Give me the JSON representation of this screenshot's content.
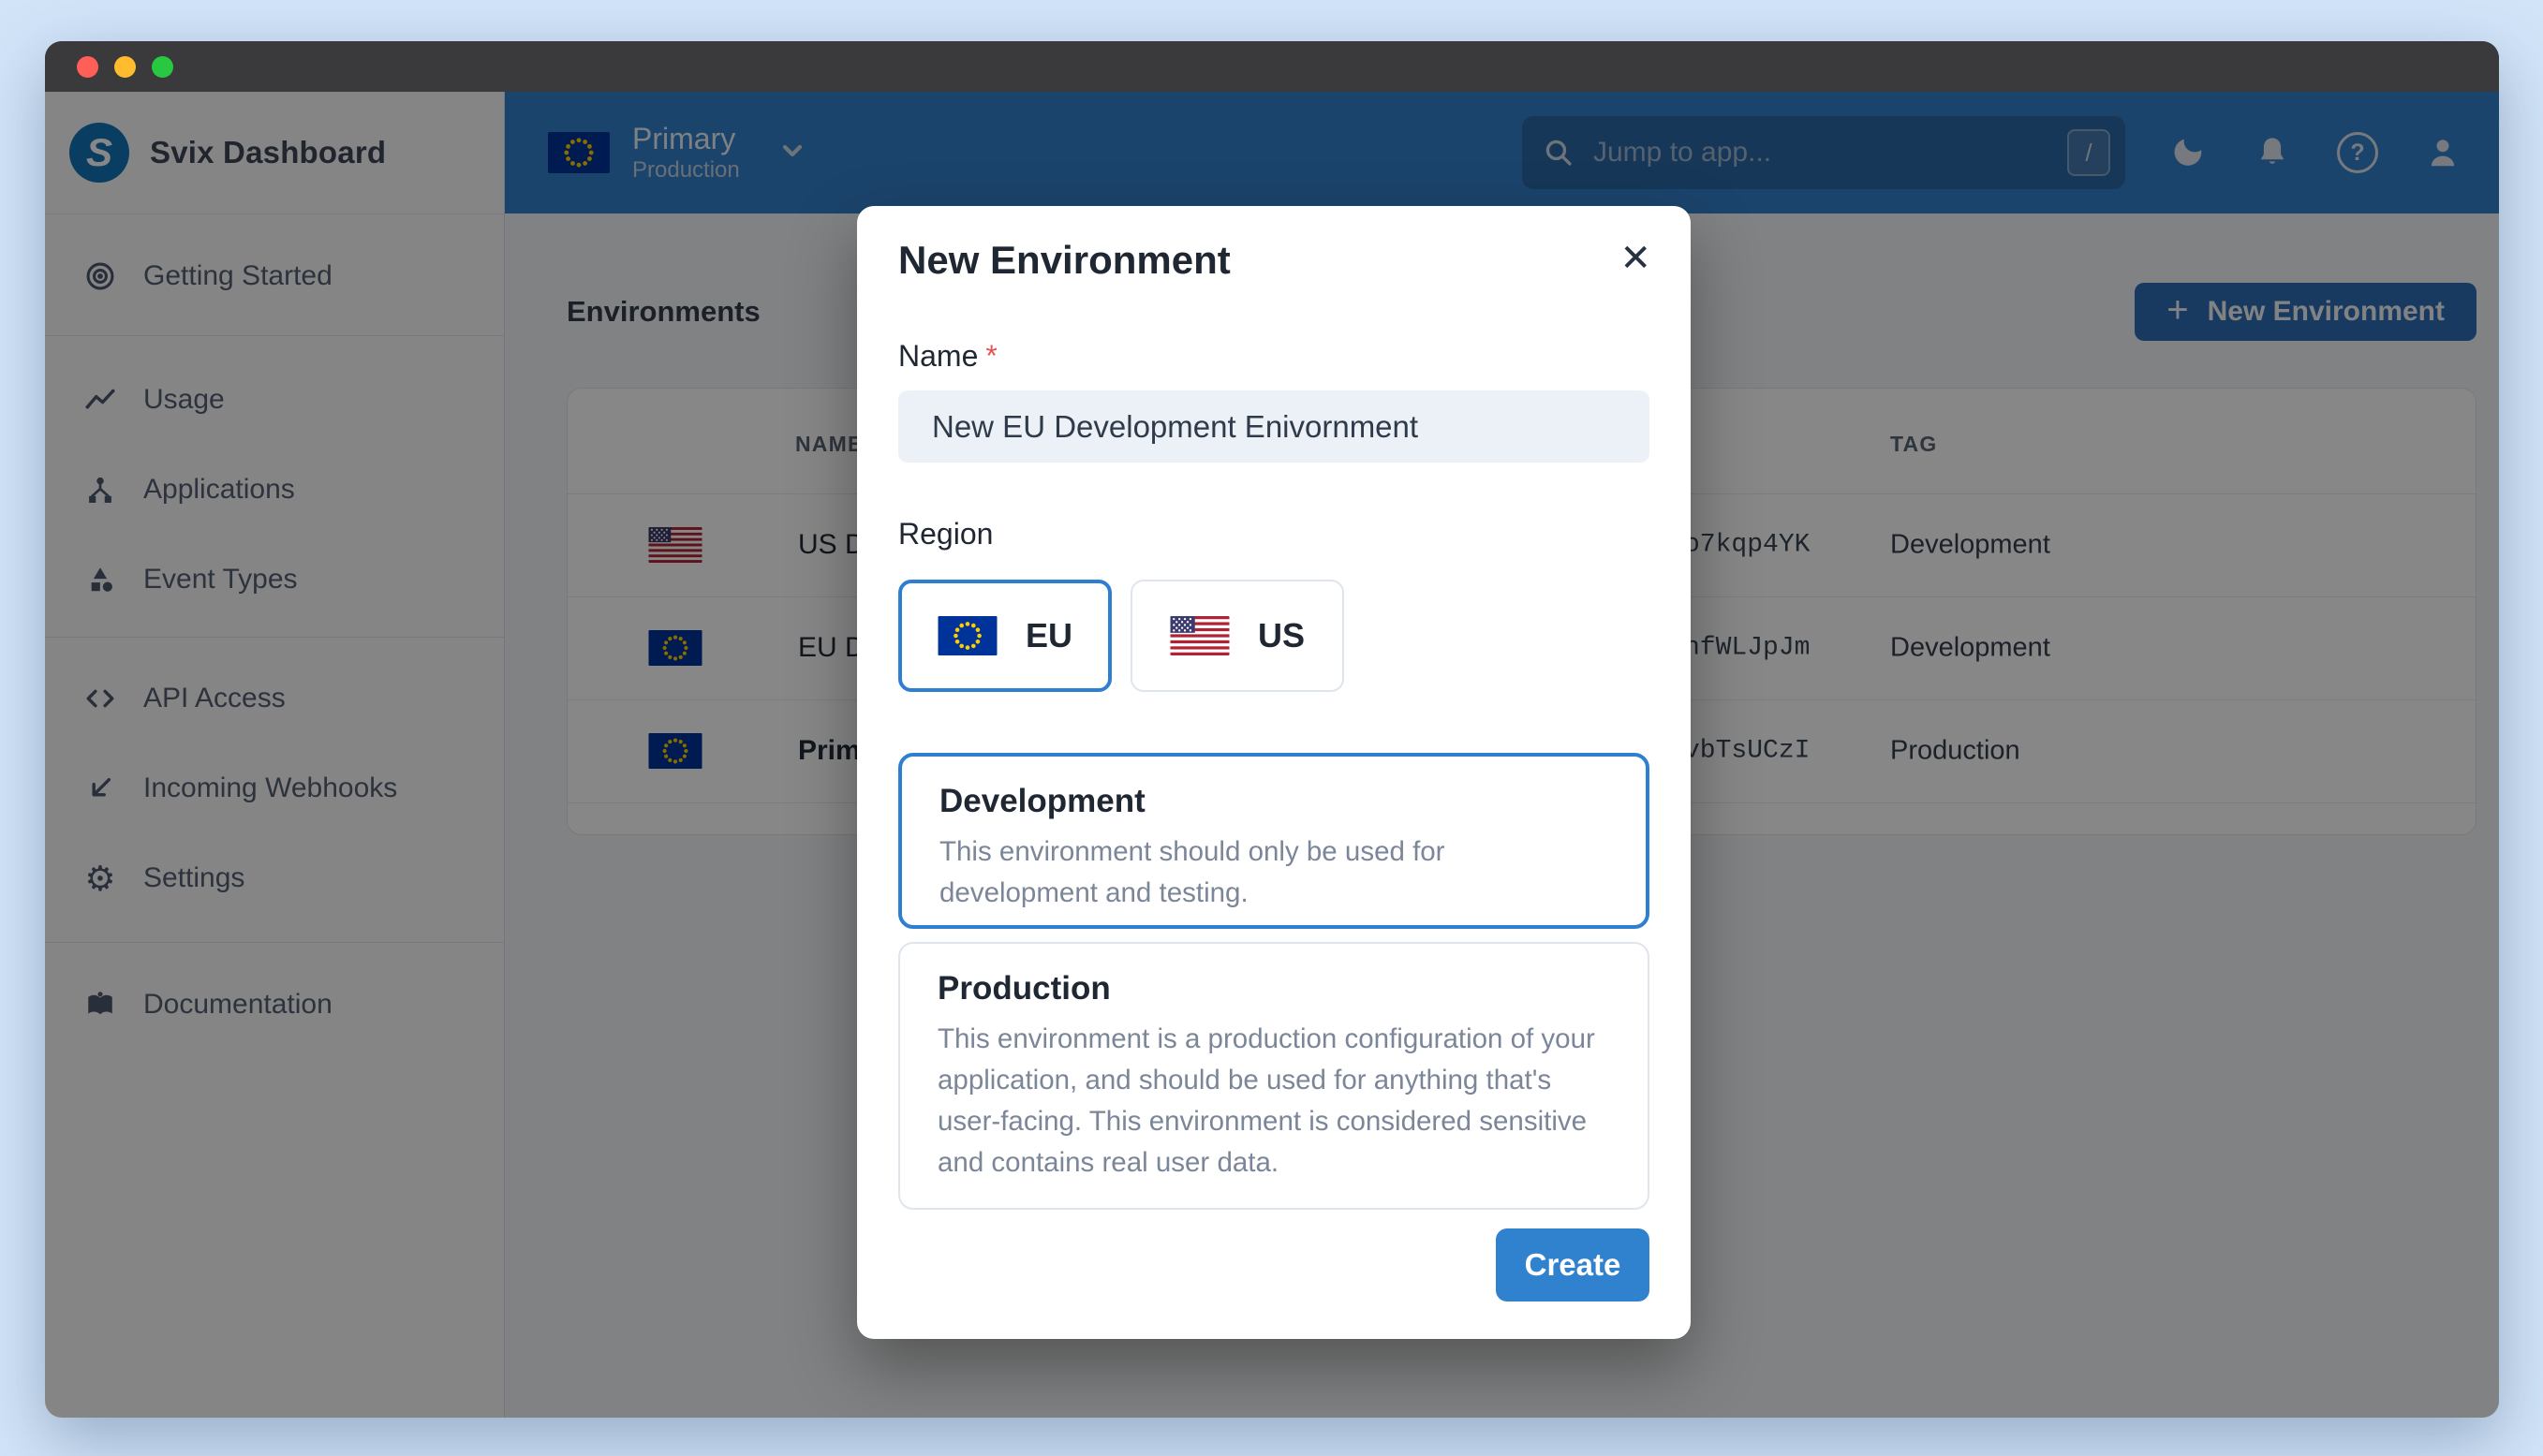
{
  "colors": {
    "accent_blue": "#3182ce",
    "topbar_blue": "#3380cc",
    "selected_border_blue": "#2f7fd1",
    "page_frame_blue": "#d2e4f8",
    "titlebar_dark": "#3a3a3c",
    "required_red": "#e25555",
    "eu_flag_blue": "#003399",
    "eu_star_yellow": "#ffcc00",
    "us_flag_red": "#b22234",
    "us_canton_blue": "#3c3b6e"
  },
  "window": {
    "traffic_lights": [
      "close",
      "minimize",
      "zoom"
    ]
  },
  "sidebar": {
    "brand": {
      "name": "Svix Dashboard",
      "logo_letter": "S"
    },
    "sections": [
      {
        "items": [
          {
            "icon": "getting-started-icon",
            "label": "Getting Started"
          }
        ]
      },
      {
        "items": [
          {
            "icon": "usage-icon",
            "label": "Usage"
          },
          {
            "icon": "applications-icon",
            "label": "Applications"
          },
          {
            "icon": "event-types-icon",
            "label": "Event Types"
          }
        ]
      },
      {
        "items": [
          {
            "icon": "api-access-icon",
            "label": "API Access"
          },
          {
            "icon": "incoming-webhooks-icon",
            "label": "Incoming Webhooks"
          },
          {
            "icon": "settings-icon",
            "label": "Settings"
          }
        ]
      },
      {
        "items": [
          {
            "icon": "documentation-icon",
            "label": "Documentation"
          }
        ]
      }
    ],
    "settings_gear_glyph": "⚙"
  },
  "topbar": {
    "environment_switcher": {
      "name": "Primary",
      "tag": "Production",
      "flag": "eu"
    },
    "search": {
      "placeholder": "Jump to app...",
      "shortcut_key": "/"
    },
    "icons": [
      "moon-icon",
      "bell-icon",
      "help-icon",
      "account-icon"
    ],
    "help_glyph": "?"
  },
  "main": {
    "page_title": "Environments",
    "new_environment_button": {
      "label": "New Environment",
      "plus_glyph": "+"
    },
    "table": {
      "columns": [
        {
          "label": "NAME"
        },
        {
          "label": "TAG"
        }
      ],
      "rows": [
        {
          "flag": "us",
          "name_visible": "US D",
          "id_visible": "o7kqp4YK",
          "tag": "Development"
        },
        {
          "flag": "eu",
          "name_visible": "EU D",
          "id_visible": "nfWLJpJm",
          "tag": "Development"
        },
        {
          "flag": "eu",
          "name_visible": "Prim",
          "id_visible": "vbTsUCzI",
          "tag": "Production"
        }
      ]
    }
  },
  "modal": {
    "title": "New Environment",
    "close_glyph": "✕",
    "name_field": {
      "label": "Name",
      "required_mark": "*",
      "value": "New EU Development Enivornment"
    },
    "region_field": {
      "label": "Region",
      "options": [
        {
          "code": "EU",
          "flag": "eu",
          "selected": true
        },
        {
          "code": "US",
          "flag": "us",
          "selected": false
        }
      ]
    },
    "type_options": [
      {
        "title": "Development",
        "description": "This environment should only be used for development and testing.",
        "selected": true
      },
      {
        "title": "Production",
        "description": "This environment is a production configuration of your application, and should be used for anything that's user-facing. This environment is considered sensitive and contains real user data.",
        "selected": false
      }
    ],
    "create_button": "Create"
  }
}
